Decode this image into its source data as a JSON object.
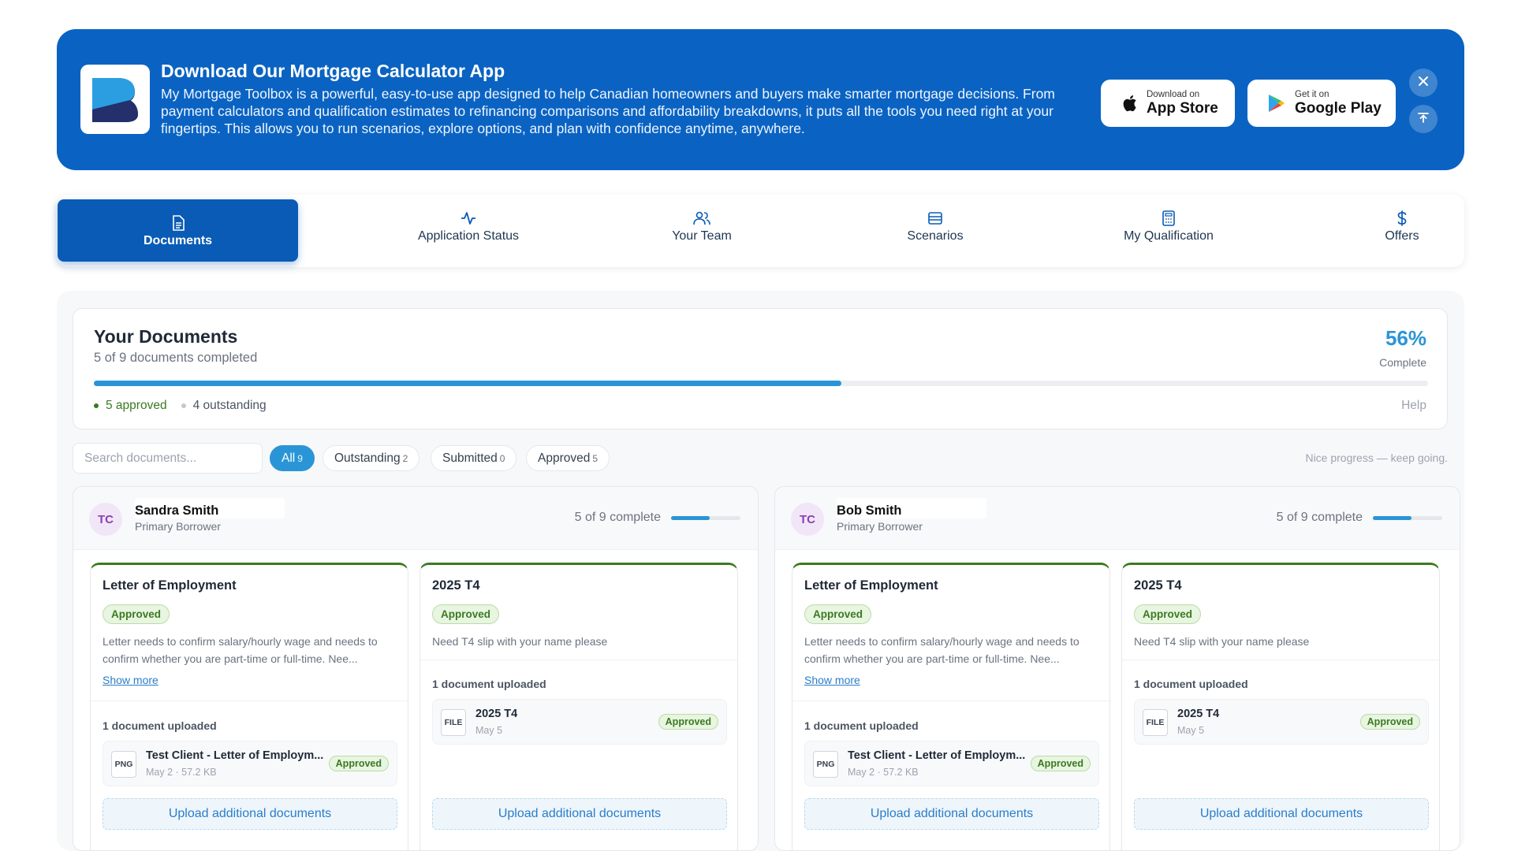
{
  "banner": {
    "title": "Download Our Mortgage Calculator App",
    "description": "My Mortgage Toolbox is a powerful, easy-to-use app designed to help Canadian homeowners and buyers make smarter mortgage decisions. From payment calculators and qualification estimates to refinancing comparisons and affordability breakdowns, it puts all the tools you need right at your fingertips. This allows you to run scenarios, explore options, and plan with confidence anytime, anywhere.",
    "app_store_small": "Download on",
    "app_store_big": "App Store",
    "google_play_small": "Get it on",
    "google_play_big": "Google Play",
    "close_icon": "close-icon",
    "share_icon": "upload-icon"
  },
  "tabs": [
    {
      "label": "Documents",
      "icon": "document-icon"
    },
    {
      "label": "Application Status",
      "icon": "activity-icon"
    },
    {
      "label": "Your Team",
      "icon": "users-icon"
    },
    {
      "label": "Scenarios",
      "icon": "wallet-icon"
    },
    {
      "label": "My Qualification",
      "icon": "calculator-icon"
    },
    {
      "label": "Offers",
      "icon": "dollar-icon"
    }
  ],
  "summary": {
    "title": "Your Documents",
    "subtitle": "5 of 9 documents completed",
    "percent": "56%",
    "percent_label": "Complete",
    "progress": 0.56,
    "approved": "5 approved",
    "outstanding": "4 outstanding",
    "help": "Help"
  },
  "filters": {
    "search_placeholder": "Search documents...",
    "chips": [
      {
        "label": "All",
        "count": "9"
      },
      {
        "label": "Outstanding",
        "count": "2"
      },
      {
        "label": "Submitted",
        "count": "0"
      },
      {
        "label": "Approved",
        "count": "5"
      }
    ],
    "message": "Nice progress — keep going."
  },
  "borrowers": [
    {
      "initials": "TC",
      "name": "Sandra Smith",
      "role": "Primary Borrower",
      "progress_text": "5 of 9 complete",
      "progress": 0.56,
      "docs": [
        {
          "title": "Letter of Employment",
          "status": "Approved",
          "description": "Letter needs to confirm salary/hourly wage and needs to confirm whether you are part-time or full-time. Nee...",
          "show_more": "Show more",
          "uploaded": "1 document uploaded",
          "file": {
            "type": "PNG",
            "name": "Test Client - Letter of Employm...",
            "meta": "May 2 · 57.2 KB",
            "status": "Approved"
          },
          "upload_button": "Upload additional documents"
        },
        {
          "title": "2025 T4",
          "status": "Approved",
          "description": "Need T4 slip with your name please",
          "uploaded": "1 document uploaded",
          "file": {
            "type": "FILE",
            "name": "2025 T4",
            "meta": "May 5",
            "status": "Approved"
          },
          "upload_button": "Upload additional documents"
        }
      ]
    },
    {
      "initials": "TC",
      "name": "Bob Smith",
      "role": "Primary Borrower",
      "progress_text": "5 of 9 complete",
      "progress": 0.56,
      "docs": [
        {
          "title": "Letter of Employment",
          "status": "Approved",
          "description": "Letter needs to confirm salary/hourly wage and needs to confirm whether you are part-time or full-time. Nee...",
          "show_more": "Show more",
          "uploaded": "1 document uploaded",
          "file": {
            "type": "PNG",
            "name": "Test Client - Letter of Employm...",
            "meta": "May 2 · 57.2 KB",
            "status": "Approved"
          },
          "upload_button": "Upload additional documents"
        },
        {
          "title": "2025 T4",
          "status": "Approved",
          "description": "Need T4 slip with your name please",
          "uploaded": "1 document uploaded",
          "file": {
            "type": "FILE",
            "name": "2025 T4",
            "meta": "May 5",
            "status": "Approved"
          },
          "upload_button": "Upload additional documents"
        }
      ]
    }
  ],
  "colors": {
    "primary": "#0a5bb5",
    "banner": "#0a63c2",
    "accent": "#2a95d6",
    "approved_green": "#3a7a20"
  }
}
